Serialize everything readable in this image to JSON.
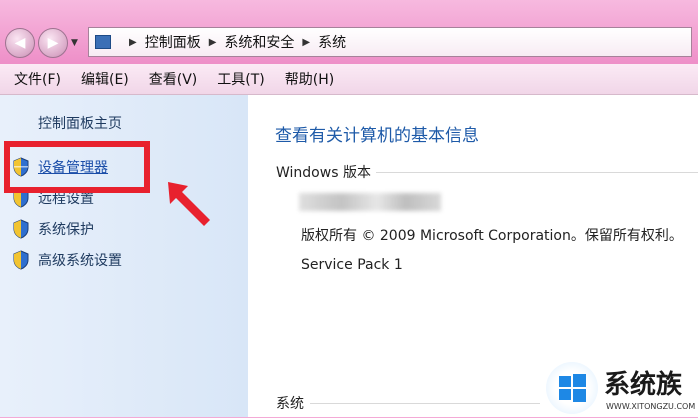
{
  "breadcrumb": {
    "items": [
      "控制面板",
      "系统和安全",
      "系统"
    ]
  },
  "menu": {
    "file": "文件(F)",
    "edit": "编辑(E)",
    "view": "查看(V)",
    "tools": "工具(T)",
    "help": "帮助(H)"
  },
  "sidebar": {
    "home": "控制面板主页",
    "items": [
      {
        "label": "设备管理器",
        "icon": "shield-icon"
      },
      {
        "label": "远程设置",
        "icon": "shield-icon"
      },
      {
        "label": "系统保护",
        "icon": "shield-icon"
      },
      {
        "label": "高级系统设置",
        "icon": "shield-icon"
      }
    ]
  },
  "main": {
    "heading": "查看有关计算机的基本信息",
    "windows_section": "Windows 版本",
    "copyright": "版权所有 © 2009 Microsoft Corporation。保留所有权利。",
    "service_pack": "Service Pack 1",
    "system_section": "系统"
  },
  "watermark": {
    "brand": "系统族",
    "url": "WWW.XITONGZU.COM"
  },
  "colors": {
    "titlebar": "#f4a9d6",
    "highlight": "#e8212e",
    "link": "#1a4da8",
    "heading": "#1e5aa8"
  }
}
